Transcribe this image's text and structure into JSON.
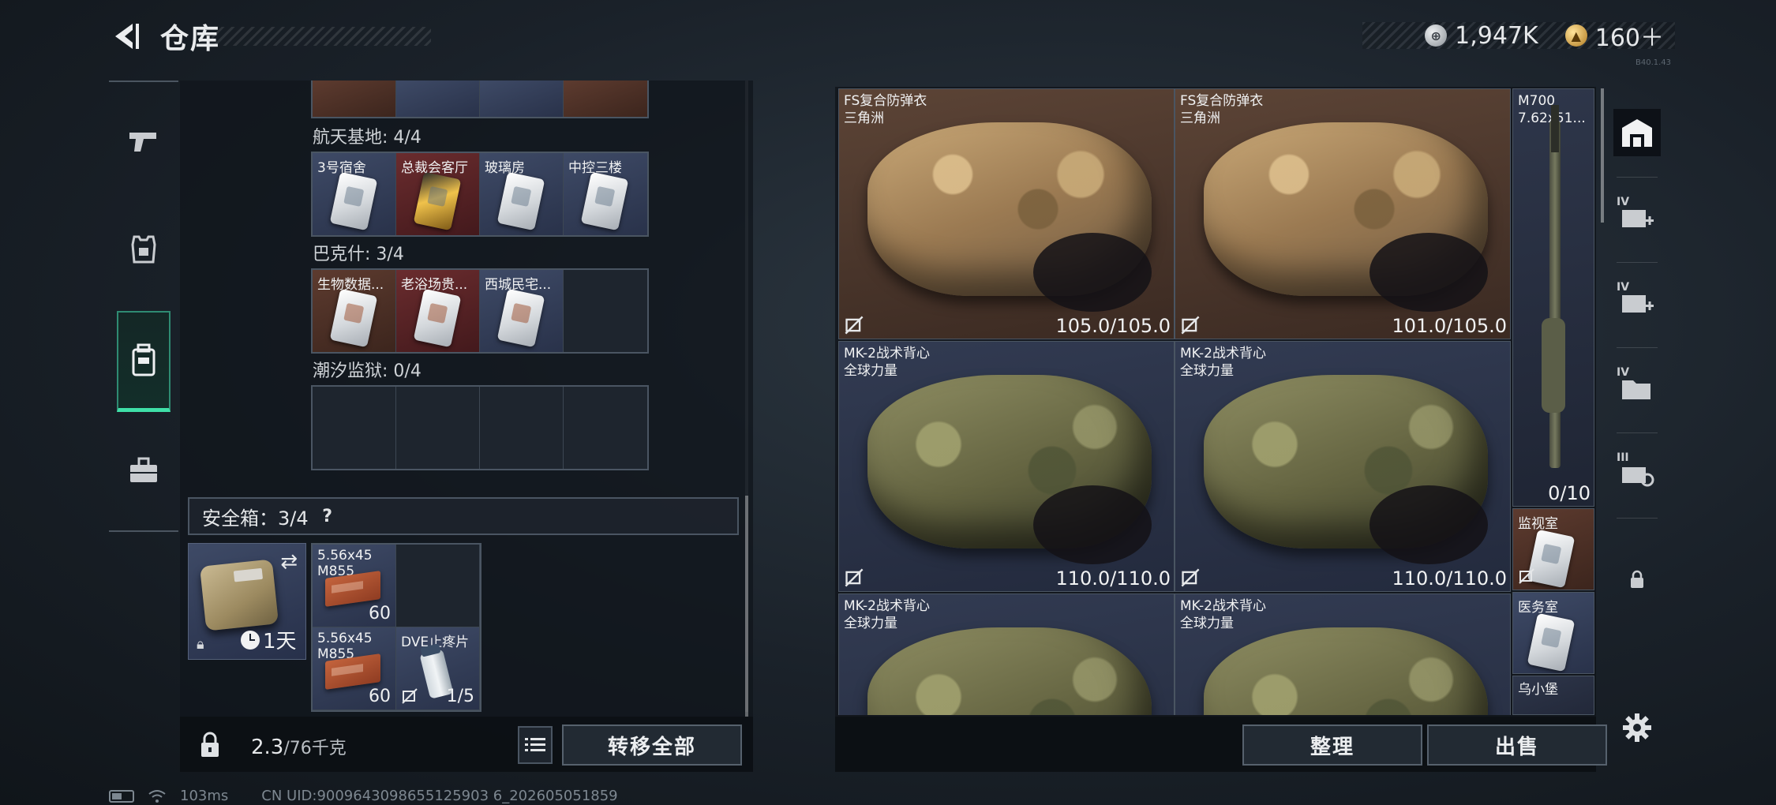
{
  "header": {
    "title": "仓库",
    "currency": [
      {
        "icon": "silver-coin-icon",
        "value": "1,947K"
      },
      {
        "icon": "gold-coin-icon",
        "value": "160＋"
      }
    ],
    "version": "B40.1.43"
  },
  "left_nav": [
    {
      "name": "weapons",
      "icon": "pistol-icon"
    },
    {
      "name": "gear",
      "icon": "armor-icon"
    },
    {
      "name": "storage",
      "icon": "backpack-icon",
      "active": true
    },
    {
      "name": "toolbox",
      "icon": "briefcase-icon"
    }
  ],
  "storage": {
    "sections": [
      {
        "label": "航天基地: 4/4",
        "cells": [
          {
            "name": "3号宿舍",
            "color": "blue"
          },
          {
            "name": "总裁会客厅",
            "color": "red",
            "card": "gold"
          },
          {
            "name": "玻璃房",
            "color": "blue"
          },
          {
            "name": "中控三楼",
            "color": "blue"
          }
        ]
      },
      {
        "label": "巴克什: 3/4",
        "cells": [
          {
            "name": "生物数据...",
            "color": "brown"
          },
          {
            "name": "老浴场贵...",
            "color": "red"
          },
          {
            "name": "西城民宅...",
            "color": "blue"
          },
          {
            "name": "",
            "color": "empty"
          }
        ]
      },
      {
        "label": "潮汐监狱: 0/4",
        "cells": [
          {
            "name": "",
            "color": "empty"
          },
          {
            "name": "",
            "color": "empty"
          },
          {
            "name": "",
            "color": "empty"
          },
          {
            "name": "",
            "color": "empty"
          }
        ]
      }
    ],
    "safebox": {
      "label": "安全箱：3/4",
      "help": "?",
      "case_timer": "1天",
      "items": [
        {
          "name": "5.56x45\nM855",
          "count": "60",
          "type": "ammo"
        },
        {
          "name": "",
          "count": "",
          "type": "empty"
        },
        {
          "name": "5.56x45\nM855",
          "count": "60",
          "type": "ammo"
        },
        {
          "name": "DVE止疼片",
          "count": "1/5",
          "type": "medicine"
        }
      ]
    },
    "weight": {
      "current": "2.3",
      "max": "/76千克"
    },
    "transfer_all": "转移全部"
  },
  "items": [
    {
      "name": "FS复合防弹衣\n三角洲",
      "durability": "105.0/105.0",
      "style": "desert",
      "bg": "brown"
    },
    {
      "name": "FS复合防弹衣\n三角洲",
      "durability": "101.0/105.0",
      "style": "desert",
      "bg": "brown"
    },
    {
      "name": "MK-2战术背心\n全球力量",
      "durability": "110.0/110.0",
      "style": "olive",
      "bg": "navy"
    },
    {
      "name": "MK-2战术背心\n全球力量",
      "durability": "110.0/110.0",
      "style": "olive",
      "bg": "navy"
    },
    {
      "name": "MK-2战术背心\n全球力量",
      "durability": "",
      "style": "olive",
      "bg": "navy"
    },
    {
      "name": "MK-2战术背心\n全球力量",
      "durability": "",
      "style": "olive",
      "bg": "navy"
    }
  ],
  "side_items": {
    "rifle": {
      "name": "M700\n7.62x51...",
      "count": "0/10"
    },
    "cards": [
      {
        "name": "监视室",
        "color": "brown"
      },
      {
        "name": "医务室",
        "color": "blue"
      },
      {
        "name": "乌小堡",
        "color": "navy"
      }
    ]
  },
  "actions": {
    "sort": "整理",
    "sell": "出售"
  },
  "right_nav": [
    {
      "icon": "warehouse-icon",
      "tier": ""
    },
    {
      "icon": "expand-storage-icon",
      "tier": "IV"
    },
    {
      "icon": "expand-storage-icon",
      "tier": "IV"
    },
    {
      "icon": "folder-storage-icon",
      "tier": "IV"
    },
    {
      "icon": "storage-case-icon",
      "tier": "III"
    },
    {
      "icon": "lock-icon",
      "tier": ""
    }
  ],
  "status": {
    "ping": "103ms",
    "uid": "CN UID:9009643098655125903 6_202605051859"
  }
}
